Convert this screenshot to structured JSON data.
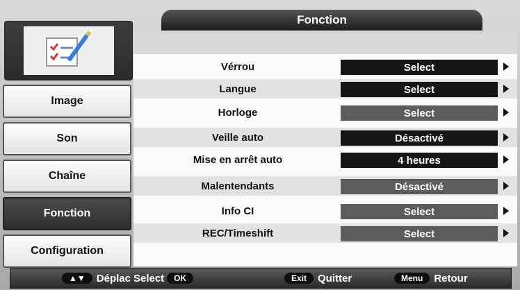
{
  "header": {
    "title": "Fonction"
  },
  "sidebar": {
    "items": [
      {
        "label": "Image"
      },
      {
        "label": "Son"
      },
      {
        "label": "Chaîne"
      },
      {
        "label": "Fonction",
        "active": true
      },
      {
        "label": "Configuration"
      }
    ]
  },
  "settings": {
    "rows": [
      {
        "label": "Vérrou",
        "value": "Select"
      },
      {
        "label": "Langue",
        "value": "Select"
      },
      {
        "label": "Horloge",
        "value": "Select"
      },
      {
        "label": "Veille auto",
        "value": "Désactivé"
      },
      {
        "label": "Mise en arrêt auto",
        "value": "4 heures"
      },
      {
        "label": "Malentendants",
        "value": "Désactivé"
      },
      {
        "label": "Info CI",
        "value": "Select"
      },
      {
        "label": "REC/Timeshift",
        "value": "Select"
      }
    ]
  },
  "footer": {
    "nav_key": "▲▼",
    "nav_label": "Déplac",
    "select_label": "Select",
    "ok_key": "OK",
    "exit_key": "Exit",
    "exit_label": "Quitter",
    "menu_key": "Menu",
    "menu_label": "Retour"
  },
  "colors": {
    "active_bg": "#2e2e2e",
    "value_bg": "#151515",
    "value_dim_bg": "#5c5c5c",
    "content_bg": "#fafafa"
  }
}
